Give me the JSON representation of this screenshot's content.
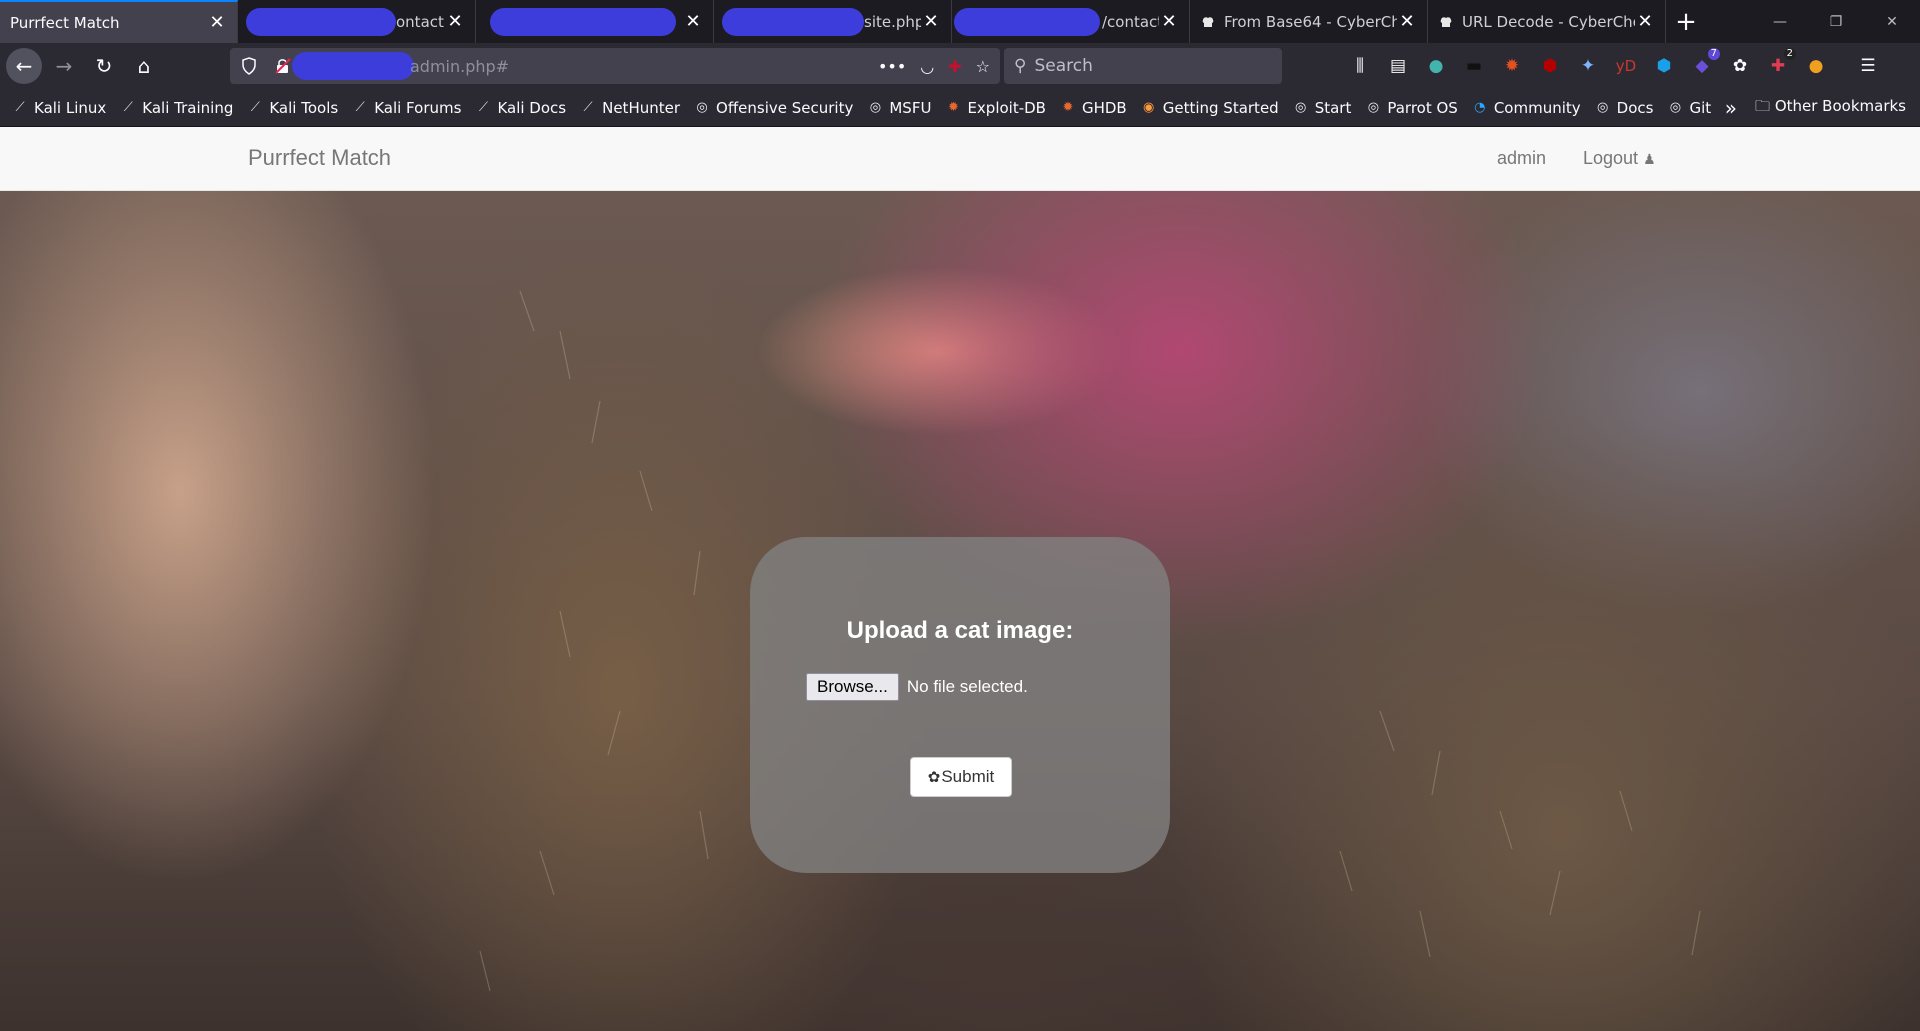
{
  "browser": {
    "tabs": [
      {
        "title": "Purrfect Match",
        "active": true,
        "redacted": false
      },
      {
        "title": "ontact",
        "active": false,
        "redacted": true
      },
      {
        "title": "",
        "active": false,
        "redacted": true
      },
      {
        "title": "site.php",
        "active": false,
        "redacted": true
      },
      {
        "title": "/contact",
        "active": false,
        "redacted": true
      },
      {
        "title": "From Base64 - CyberChef",
        "active": false,
        "redacted": false
      },
      {
        "title": "URL Decode - CyberChef",
        "active": false,
        "redacted": false
      }
    ],
    "url": "admin.php#",
    "search_placeholder": "Search",
    "badges": {
      "extension_purple": "7",
      "extension_red": "2"
    },
    "bookmarks": [
      {
        "label": "Kali Linux",
        "icon": "kali-dragon-icon"
      },
      {
        "label": "Kali Training",
        "icon": "kali-dragon-icon"
      },
      {
        "label": "Kali Tools",
        "icon": "kali-dragon-icon"
      },
      {
        "label": "Kali Forums",
        "icon": "kali-dragon-icon"
      },
      {
        "label": "Kali Docs",
        "icon": "kali-dragon-icon"
      },
      {
        "label": "NetHunter",
        "icon": "kali-dragon-icon"
      },
      {
        "label": "Offensive Security",
        "icon": "globe-icon"
      },
      {
        "label": "MSFU",
        "icon": "globe-icon"
      },
      {
        "label": "Exploit-DB",
        "icon": "exploitdb-icon"
      },
      {
        "label": "GHDB",
        "icon": "exploitdb-icon"
      },
      {
        "label": "Getting Started",
        "icon": "firefox-icon"
      },
      {
        "label": "Start",
        "icon": "globe-icon"
      },
      {
        "label": "Parrot OS",
        "icon": "globe-icon"
      },
      {
        "label": "Community",
        "icon": "parrot-icon"
      },
      {
        "label": "Docs",
        "icon": "globe-icon"
      },
      {
        "label": "Git",
        "icon": "globe-icon"
      }
    ],
    "other_bookmarks": "Other Bookmarks"
  },
  "site": {
    "brand": "Purrfect Match",
    "nav_admin": "admin",
    "nav_logout": "Logout"
  },
  "upload": {
    "title": "Upload a cat image:",
    "browse_label": "Browse...",
    "file_status": "No file selected.",
    "submit_label": "Submit"
  },
  "colors": {
    "accent": "#0a84ff",
    "redaction": "#3d3ddc",
    "panel": "#828282"
  }
}
